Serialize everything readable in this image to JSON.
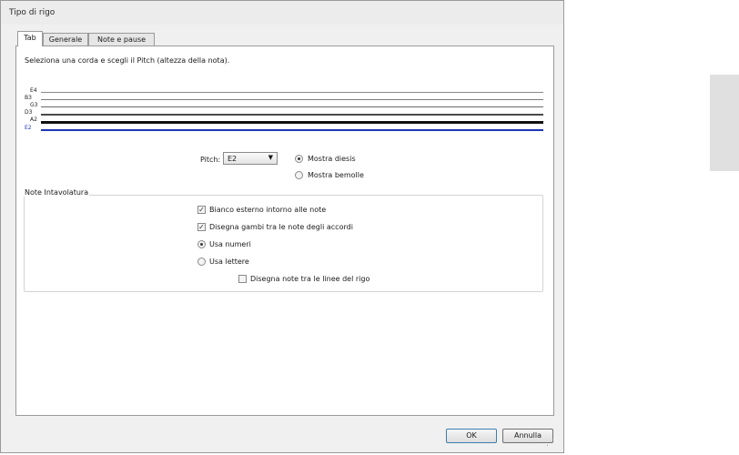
{
  "window": {
    "title": "Tipo di rigo"
  },
  "tabs": [
    {
      "label": "Tab",
      "active": true
    },
    {
      "label": "Generale",
      "active": false
    },
    {
      "label": "Note e pause",
      "active": false
    }
  ],
  "tab_page": {
    "instruction": "Seleziona una corda e scegli il Pitch (altezza della nota).",
    "strings": [
      "E4",
      "B3",
      "G3",
      "D3",
      "A2",
      "E2"
    ],
    "selected_string": "E2",
    "pitch": {
      "label": "Pitch:",
      "value": "E2"
    },
    "accidentals": [
      {
        "label": "Mostra diesis",
        "checked": true
      },
      {
        "label": "Mostra bemolle",
        "checked": false
      }
    ],
    "group": {
      "title": "Note Intavolatura",
      "checkboxes": [
        {
          "label": "Bianco esterno intorno alle note",
          "checked": true
        },
        {
          "label": "Disegna gambi tra le note degli accordi",
          "checked": true
        }
      ],
      "radios": [
        {
          "label": "Usa numeri",
          "checked": true
        },
        {
          "label": "Usa lettere",
          "checked": false
        }
      ],
      "sub_checkbox": {
        "label": "Disegna note tra le linee del rigo",
        "checked": false
      }
    }
  },
  "buttons": {
    "ok": "OK",
    "cancel": "Annulla"
  },
  "colors": {
    "selected_string": "#1e36b4",
    "accent": "#3c7fb1"
  }
}
